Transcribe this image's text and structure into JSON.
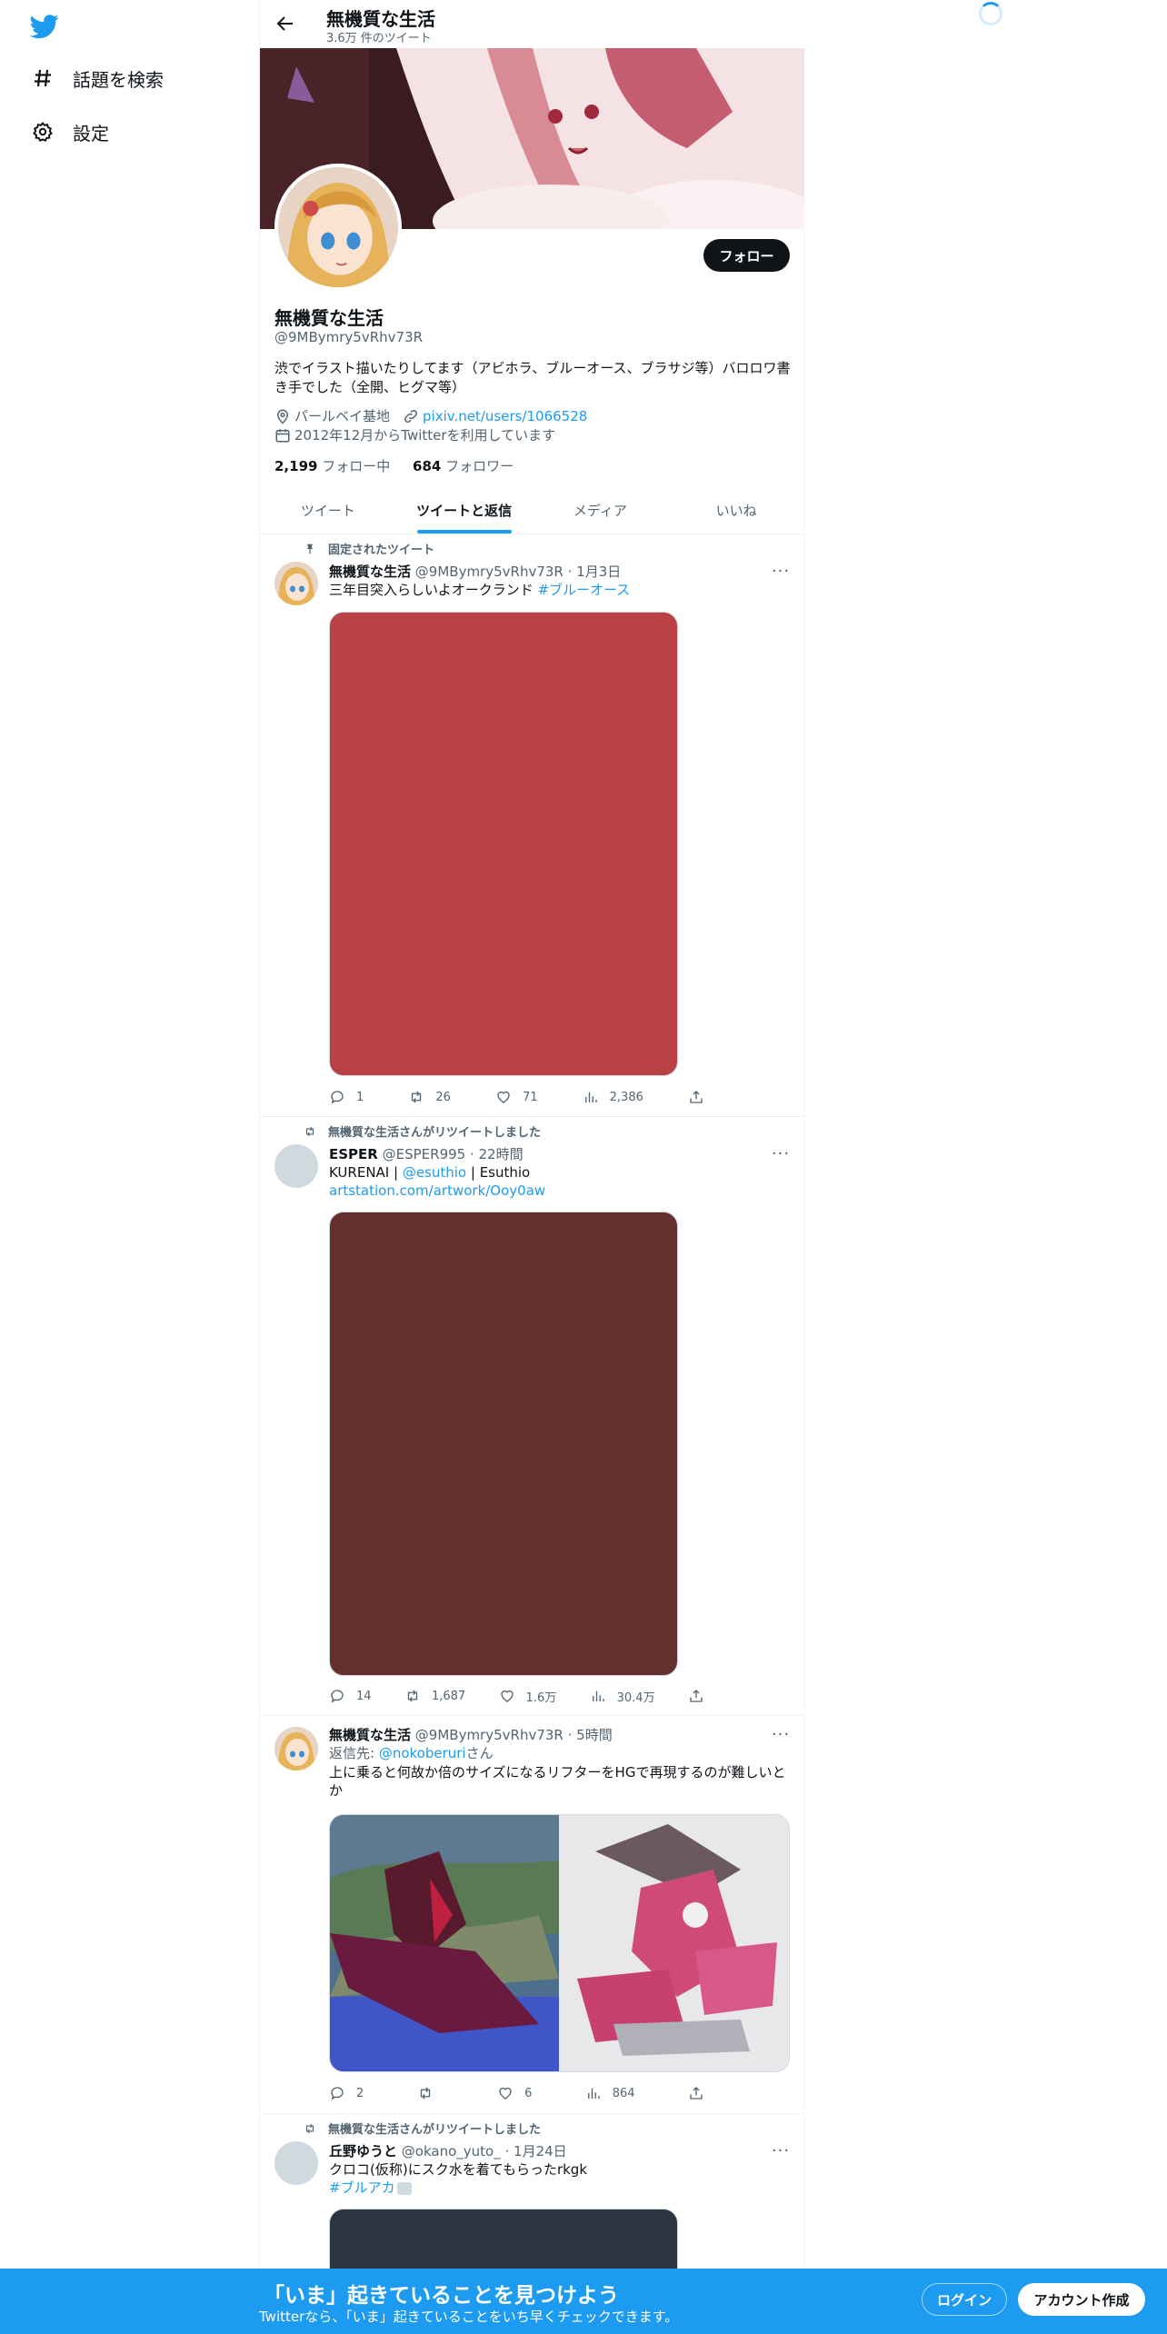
{
  "nav": {
    "items": [
      {
        "label": "話題を検索",
        "icon": "hashtag-icon"
      },
      {
        "label": "設定",
        "icon": "gear-icon"
      }
    ]
  },
  "header": {
    "name": "無機質な生活",
    "tweet_count": "3.6万 件のツイート"
  },
  "profile": {
    "name": "無機質な生活",
    "handle": "@9MBymry5vRhv73R",
    "bio": "渋でイラスト描いたりしてます（アビホラ、ブルーオース、ブラサジ等）バロロワ書き手でした（全開、ヒグマ等）",
    "location": "パールベイ基地",
    "website": "pixiv.net/users/1066528",
    "joined": "2012年12月からTwitterを利用しています",
    "following_count": "2,199",
    "following_label": " フォロー中",
    "followers_count": "684",
    "followers_label": " フォロワー",
    "follow_button": "フォロー"
  },
  "tabs": [
    {
      "label": "ツイート",
      "active": false
    },
    {
      "label": "ツイートと返信",
      "active": true
    },
    {
      "label": "メディア",
      "active": false
    },
    {
      "label": "いいね",
      "active": false
    }
  ],
  "tweets": [
    {
      "context": "固定されたツイート",
      "name": "無機質な生活",
      "handle_time": "@9MBymry5vRhv73R · 1月3日",
      "text": "三年目突入らしいよオークランド ",
      "hashtag": "#ブルーオース",
      "media_color": "#b94045",
      "reply": "1",
      "retweet": "26",
      "like": "71",
      "views": "2,386"
    },
    {
      "context": "無機質な生活さんがリツイートしました",
      "name": "ESPER",
      "handle_time": "@ESPER995 · 22時間",
      "text_line1_a": "KURENAI | ",
      "mention": "@esuthio",
      "text_line1_b": " | Esuthio",
      "link": "artstation.com/artwork/Ooy0aw",
      "media_color": "#642f2c",
      "reply": "14",
      "retweet": "1,687",
      "like": "1.6万",
      "views": "30.4万"
    },
    {
      "name": "無機質な生活",
      "handle_time": "@9MBymry5vRhv73R · 5時間",
      "reply_to_prefix": "返信先: ",
      "reply_to": "@nokoberuri",
      "reply_to_suffix": "さん",
      "text": "上に乗ると何故か倍のサイズになるリフターをHGで再現するのが難しいとか",
      "reply": "2",
      "retweet": "",
      "like": "6",
      "views": "864"
    },
    {
      "context": "無機質な生活さんがリツイートしました",
      "name": "丘野ゆうと",
      "handle_time": "@okano_yuto_ · 1月24日",
      "text": "クロコ(仮称)にスク水を着てもらったrkgk",
      "hashtag": "#ブルアカ",
      "media_color": "#2a3540"
    }
  ],
  "bottom": {
    "title": "「いま」起きていることを見つけよう",
    "subtitle": "Twitterなら、「いま」起きていることをいち早くチェックできます。",
    "login": "ログイン",
    "signup": "アカウント作成"
  },
  "colors": {
    "accent": "#1d9bf0",
    "text": "#0f1419",
    "muted": "#536471"
  }
}
